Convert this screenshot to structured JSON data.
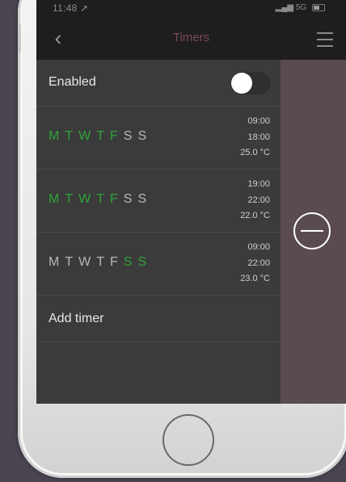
{
  "status": {
    "time": "11:48",
    "signal": "5G"
  },
  "header": {
    "title": "Timers",
    "back_glyph": "‹"
  },
  "enabled": {
    "label": "Enabled",
    "on": true
  },
  "colors": {
    "active_day": "#2fa43a",
    "inactive_day": "#b8b8b8",
    "title": "#7a4a58",
    "delete_panel": "#5a4b4f"
  },
  "timers": [
    {
      "days": [
        {
          "letter": "M",
          "active": true
        },
        {
          "letter": "T",
          "active": true
        },
        {
          "letter": "W",
          "active": true
        },
        {
          "letter": "T",
          "active": true
        },
        {
          "letter": "F",
          "active": true
        },
        {
          "letter": "S",
          "active": false
        },
        {
          "letter": "S",
          "active": false
        }
      ],
      "start": "09:00",
      "end": "18:00",
      "temp": "25.0 °C"
    },
    {
      "days": [
        {
          "letter": "M",
          "active": true
        },
        {
          "letter": "T",
          "active": true
        },
        {
          "letter": "W",
          "active": true
        },
        {
          "letter": "T",
          "active": true
        },
        {
          "letter": "F",
          "active": true
        },
        {
          "letter": "S",
          "active": false
        },
        {
          "letter": "S",
          "active": false
        }
      ],
      "start": "19:00",
      "end": "22:00",
      "temp": "22.0 °C"
    },
    {
      "days": [
        {
          "letter": "M",
          "active": false
        },
        {
          "letter": "T",
          "active": false
        },
        {
          "letter": "W",
          "active": false
        },
        {
          "letter": "T",
          "active": false
        },
        {
          "letter": "F",
          "active": false
        },
        {
          "letter": "S",
          "active": true
        },
        {
          "letter": "S",
          "active": true
        }
      ],
      "start": "09:00",
      "end": "22:00",
      "temp": "23.0 °C"
    }
  ],
  "add_timer": {
    "label": "Add timer"
  },
  "icons": {
    "back": "chevron-left-icon",
    "menu": "menu-icon",
    "delete": "minus-circle-icon"
  }
}
